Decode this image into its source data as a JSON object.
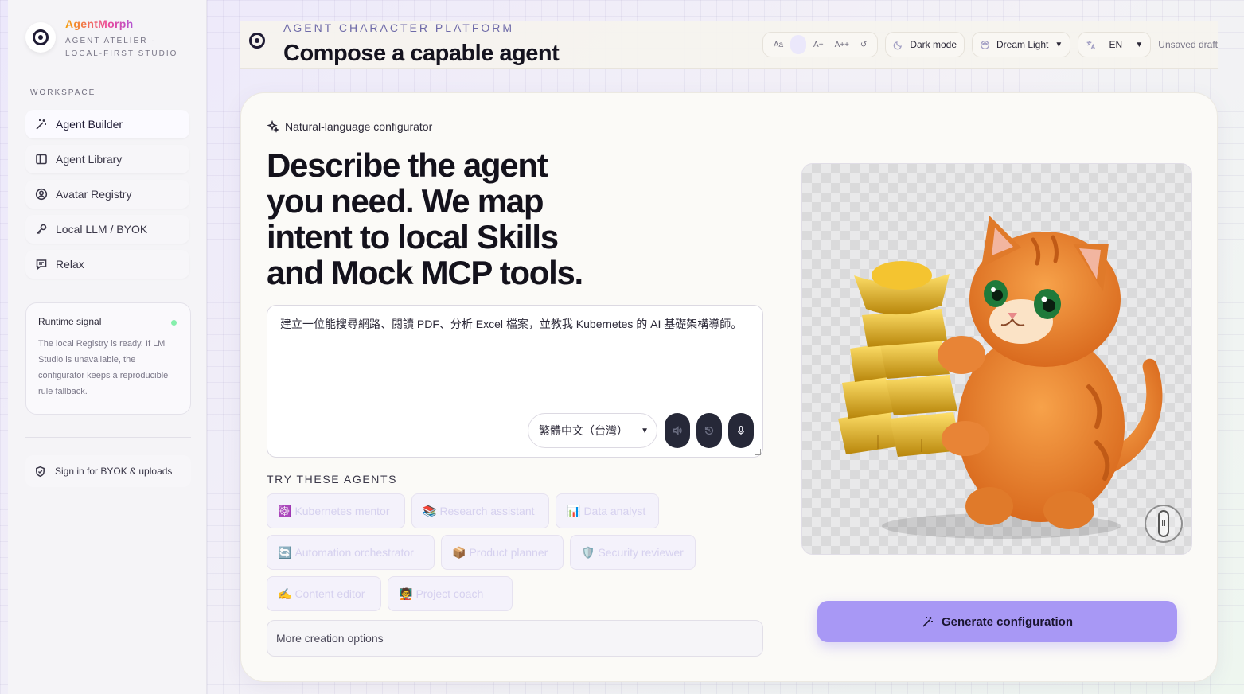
{
  "brand": {
    "name": "AgentMorph",
    "tagline": "AGENT ATELIER · LOCAL-FIRST STUDIO"
  },
  "sidebar": {
    "section_label": "WORKSPACE",
    "items": [
      {
        "label": "Agent Builder",
        "icon": "magic-wand-icon"
      },
      {
        "label": "Agent Library",
        "icon": "book-icon"
      },
      {
        "label": "Avatar Registry",
        "icon": "user-circle-icon"
      },
      {
        "label": "Local LLM / BYOK",
        "icon": "key-icon"
      },
      {
        "label": "Relax",
        "icon": "chat-icon"
      }
    ],
    "signal": {
      "title": "Runtime signal",
      "text": "The local Registry is ready. If LM Studio is unavailable, the configurator keeps a reproducible rule fallback.",
      "status_color": "#86efac"
    },
    "signin_label": "Sign in for BYOK & uploads"
  },
  "header": {
    "eyebrow": "AGENT CHARACTER PLATFORM",
    "title": "Compose a capable agent",
    "font_controls": [
      "Aa",
      "A+",
      "A++",
      "↺"
    ],
    "dark_mode_label": "Dark mode",
    "theme_value": "Dream Light",
    "language_value": "EN",
    "draft_status": "Unsaved draft"
  },
  "main": {
    "configurator_label": "Natural-language configurator",
    "headline": "Describe the agent you need. We map intent to local Skills and Mock MCP tools.",
    "prompt_value": "建立一位能搜尋網路、閱讀 PDF、分析 Excel 檔案，並教我 Kubernetes 的 AI 基礎架構導師。",
    "prompt_language": "繁體中文（台灣）",
    "try_label": "TRY THESE AGENTS",
    "presets": [
      {
        "emoji": "☸️",
        "label": "Kubernetes mentor"
      },
      {
        "emoji": "📚",
        "label": "Research assistant"
      },
      {
        "emoji": "📊",
        "label": "Data analyst"
      },
      {
        "emoji": "🔄",
        "label": "Automation orchestrator"
      },
      {
        "emoji": "📦",
        "label": "Product planner"
      },
      {
        "emoji": "🛡️",
        "label": "Security reviewer"
      },
      {
        "emoji": "✍️",
        "label": "Content editor"
      },
      {
        "emoji": "🧑‍🏫",
        "label": "Project coach"
      }
    ],
    "more_options_label": "More creation options",
    "generate_label": "Generate configuration",
    "accent_color": "#a898f5"
  }
}
